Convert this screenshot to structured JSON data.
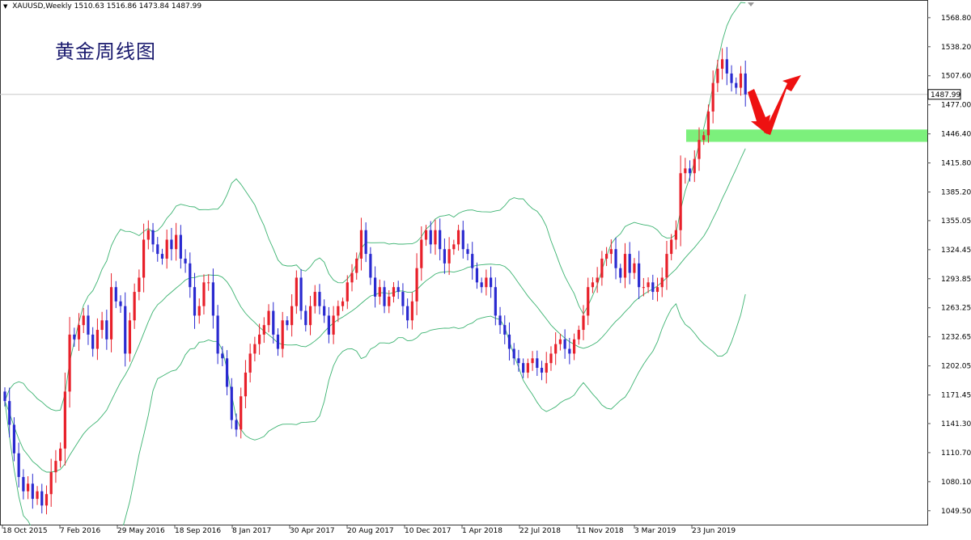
{
  "header": {
    "symbol_timeframe": "XAUUSD,Weekly",
    "ohlc": "1510.63 1516.86 1473.84 1487.99"
  },
  "title_cn": "黄金周线图",
  "price_tag": "1487.99",
  "colors": {
    "bull": "#e8202a",
    "bear": "#2a2ad0",
    "band": "#3cb371",
    "zone": "#7cf07c",
    "arrow": "#ee1111",
    "price_line": "#c8c8c8",
    "axis": "#555555"
  },
  "icons": [
    "arrow-down-icon",
    "arrow-up-icon"
  ],
  "chart_data": {
    "type": "candlestick",
    "title": "黄金周线图",
    "ylim": [
      1034,
      1584
    ],
    "y_ticks": [
      "1568.80",
      "1538.20",
      "1507.60",
      "1477.00",
      "1446.40",
      "1415.80",
      "1385.20",
      "1355.05",
      "1324.45",
      "1293.85",
      "1263.25",
      "1232.65",
      "1202.05",
      "1171.45",
      "1141.30",
      "1110.70",
      "1080.10",
      "1049.50"
    ],
    "x_ticks": [
      "18 Oct 2015",
      "7 Feb 2016",
      "29 May 2016",
      "18 Sep 2016",
      "8 Jan 2017",
      "30 Apr 2017",
      "20 Aug 2017",
      "10 Dec 2017",
      "1 Apr 2018",
      "22 Jul 2018",
      "11 Nov 2018",
      "3 Mar 2019",
      "23 Jun 2019"
    ],
    "last_price": 1487.99,
    "support_zone": [
      1438,
      1451
    ],
    "close": [
      1165,
      1140,
      1110,
      1085,
      1070,
      1078,
      1062,
      1070,
      1055,
      1067,
      1090,
      1102,
      1115,
      1175,
      1235,
      1230,
      1245,
      1255,
      1235,
      1220,
      1240,
      1250,
      1230,
      1285,
      1270,
      1265,
      1215,
      1250,
      1280,
      1295,
      1335,
      1345,
      1330,
      1320,
      1315,
      1335,
      1325,
      1340,
      1315,
      1310,
      1285,
      1255,
      1265,
      1290,
      1290,
      1255,
      1215,
      1210,
      1180,
      1145,
      1135,
      1170,
      1195,
      1215,
      1225,
      1235,
      1245,
      1260,
      1235,
      1220,
      1250,
      1245,
      1265,
      1295,
      1260,
      1245,
      1265,
      1280,
      1265,
      1255,
      1235,
      1255,
      1265,
      1270,
      1290,
      1300,
      1315,
      1345,
      1320,
      1295,
      1275,
      1285,
      1265,
      1275,
      1285,
      1280,
      1265,
      1250,
      1270,
      1305,
      1335,
      1345,
      1330,
      1345,
      1325,
      1310,
      1325,
      1330,
      1345,
      1325,
      1320,
      1305,
      1290,
      1285,
      1295,
      1285,
      1255,
      1245,
      1235,
      1220,
      1210,
      1205,
      1195,
      1205,
      1210,
      1200,
      1195,
      1205,
      1215,
      1225,
      1230,
      1220,
      1215,
      1230,
      1240,
      1255,
      1285,
      1290,
      1295,
      1315,
      1320,
      1325,
      1305,
      1295,
      1320,
      1300,
      1310,
      1285,
      1285,
      1290,
      1280,
      1285,
      1295,
      1320,
      1335,
      1345,
      1405,
      1410,
      1405,
      1420,
      1440,
      1445,
      1470,
      1500,
      1515,
      1525,
      1510,
      1500,
      1495,
      1510,
      1488
    ],
    "bollinger": {
      "period": 20,
      "deviations": 2
    }
  }
}
